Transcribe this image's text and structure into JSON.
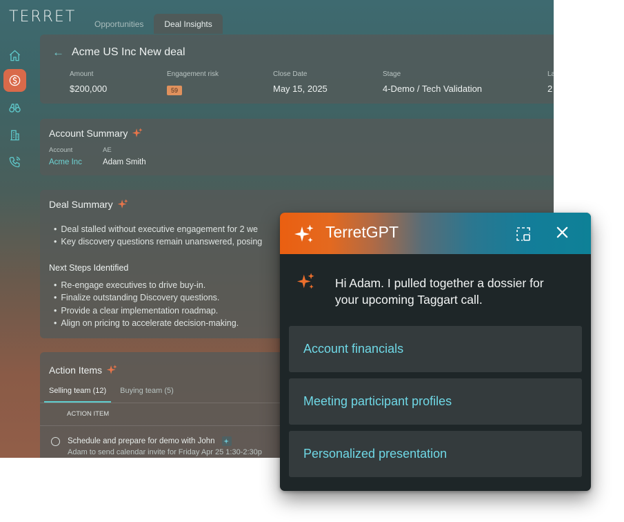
{
  "app": {
    "logo": "TERRET",
    "tabs": [
      {
        "label": "Opportunities",
        "active": false
      },
      {
        "label": "Deal Insights",
        "active": true
      }
    ],
    "sidebar": [
      {
        "icon": "home-icon"
      },
      {
        "icon": "dollar-icon",
        "active": true
      },
      {
        "icon": "binoculars-icon"
      },
      {
        "icon": "building-icon"
      },
      {
        "icon": "phone-icon"
      }
    ]
  },
  "deal": {
    "title": "Acme US Inc New deal",
    "fields": {
      "amount": {
        "label": "Amount",
        "value": "$200,000"
      },
      "risk": {
        "label": "Engagement risk",
        "value": "59"
      },
      "close_date": {
        "label": "Close Date",
        "value": "May 15, 2025"
      },
      "stage": {
        "label": "Stage",
        "value": "4-Demo / Tech Validation"
      },
      "last": {
        "label": "La",
        "value": "2"
      }
    }
  },
  "account_summary": {
    "title": "Account Summary",
    "account_label": "Account",
    "account_value": "Acme Inc",
    "ae_label": "AE",
    "ae_value": "Adam Smith"
  },
  "deal_summary": {
    "title": "Deal Summary",
    "bullets": [
      "Deal stalled without executive engagement for 2 we",
      "Key discovery questions remain unanswered, posing"
    ],
    "next_steps_title": "Next Steps Identified",
    "next_steps": [
      "Re-engage executives to drive buy-in.",
      "Finalize outstanding Discovery questions.",
      "Provide a clear implementation roadmap.",
      "Align on pricing to accelerate decision-making."
    ]
  },
  "action_items": {
    "title": "Action Items",
    "tabs": [
      {
        "label": "Selling team (12)",
        "active": true
      },
      {
        "label": "Buying team (5)",
        "active": false
      }
    ],
    "column_header": "ACTION ITEM",
    "rows": [
      {
        "title": "Schedule and prepare for demo with John",
        "subtitle": "Adam to send calendar invite for Friday Apr 25 1:30-2:30p"
      }
    ]
  },
  "gpt": {
    "title": "TerretGPT",
    "message": "Hi Adam.  I pulled together a dossier for your upcoming Taggart call.",
    "options": [
      "Account financials",
      "Meeting participant profiles",
      "Personalized presentation"
    ]
  },
  "colors": {
    "accent_teal": "#6fd8e6",
    "accent_orange": "#ea5f11",
    "risk_badge": "#e0915d",
    "nav_active": "#d96a4a"
  }
}
